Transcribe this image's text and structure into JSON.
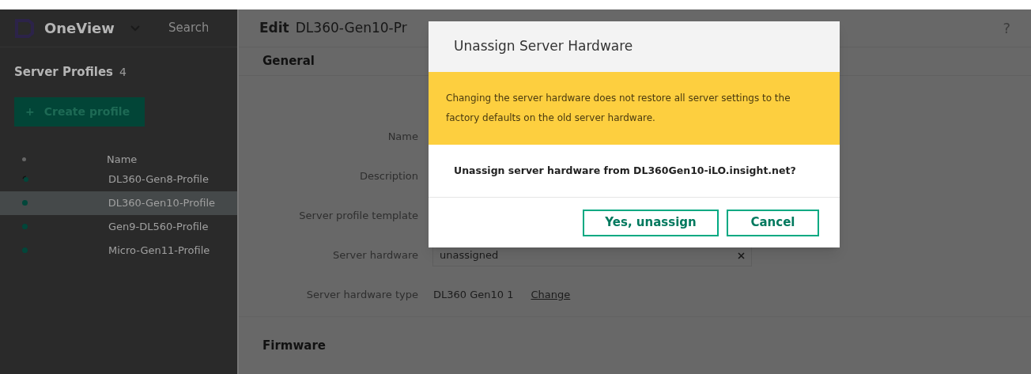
{
  "app": {
    "title": "OneView",
    "search_placeholder": "Search"
  },
  "sidebar": {
    "title": "Server Profiles",
    "count": "4",
    "create_button": "Create profile",
    "create_icon": "+",
    "column": "Name",
    "rows": [
      {
        "name": "DL360-Gen8-Profile",
        "kind": "spinner",
        "selected": false
      },
      {
        "name": "DL360-Gen10-Profile",
        "kind": "ok",
        "selected": true
      },
      {
        "name": "Gen9-DL560-Profile",
        "kind": "ok",
        "selected": false
      },
      {
        "name": "Micro-Gen11-Profile",
        "kind": "ok",
        "selected": false
      }
    ]
  },
  "editor": {
    "action": "Edit",
    "title": "DL360-Gen10-Pr",
    "help": "?",
    "section": "General",
    "fields": [
      {
        "label": "Name"
      },
      {
        "label": "Description"
      },
      {
        "label": "Server profile template"
      },
      {
        "label": "Server hardware",
        "kind": "input",
        "value": "unassigned"
      },
      {
        "label": "Server hardware type",
        "kind": "text",
        "value": "DL360 Gen10 1",
        "link": "Change"
      }
    ],
    "next_section": "Firmware"
  },
  "dialog": {
    "title": "Unassign Server Hardware",
    "warning": "Changing the server hardware does not restore all server settings to the factory defaults on the old server hardware.",
    "question": "Unassign server hardware from DL360Gen10-iLO.insight.net?",
    "buttons": [
      "Yes, unassign",
      "Cancel"
    ]
  }
}
